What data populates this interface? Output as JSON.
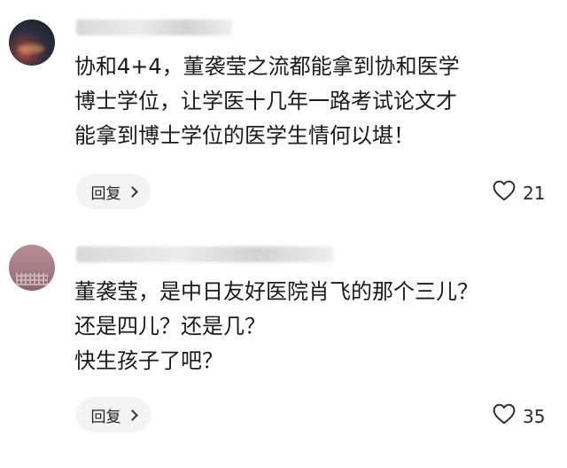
{
  "comments": [
    {
      "body": {
        "line1": "协和4+4，董袭莹之流都能拿到协和医学",
        "line2": "博士学位，让学医十几年一路考试论文才",
        "line3": "能拿到博士学位的医学生情何以堪！"
      },
      "reply_label": "回复",
      "like_count": "21"
    },
    {
      "body": {
        "line1": "董袭莹，是中日友好医院肖飞的那个三儿？",
        "line2": "还是四儿？还是几？",
        "line3": "快生孩子了吧？"
      },
      "reply_label": "回复",
      "like_count": "35"
    }
  ]
}
